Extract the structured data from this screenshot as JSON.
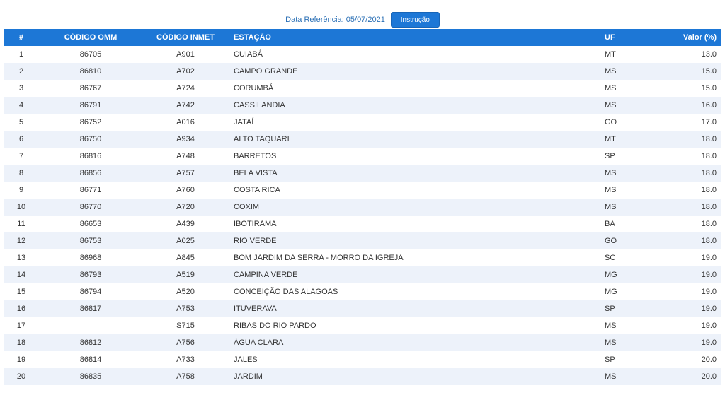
{
  "header": {
    "ref_label": "Data Referência: 05/07/2021",
    "instruction_button": "Instrução"
  },
  "table": {
    "columns": [
      "#",
      "CÓDIGO OMM",
      "CÓDIGO INMET",
      "ESTAÇÃO",
      "UF",
      "Valor (%)"
    ],
    "rows": [
      {
        "n": "1",
        "omm": "86705",
        "inmet": "A901",
        "estacao": "CUIABÁ",
        "uf": "MT",
        "valor": "13.0"
      },
      {
        "n": "2",
        "omm": "86810",
        "inmet": "A702",
        "estacao": "CAMPO GRANDE",
        "uf": "MS",
        "valor": "15.0"
      },
      {
        "n": "3",
        "omm": "86767",
        "inmet": "A724",
        "estacao": "CORUMBÁ",
        "uf": "MS",
        "valor": "15.0"
      },
      {
        "n": "4",
        "omm": "86791",
        "inmet": "A742",
        "estacao": "CASSILANDIA",
        "uf": "MS",
        "valor": "16.0"
      },
      {
        "n": "5",
        "omm": "86752",
        "inmet": "A016",
        "estacao": "JATAÍ",
        "uf": "GO",
        "valor": "17.0"
      },
      {
        "n": "6",
        "omm": "86750",
        "inmet": "A934",
        "estacao": "ALTO TAQUARI",
        "uf": "MT",
        "valor": "18.0"
      },
      {
        "n": "7",
        "omm": "86816",
        "inmet": "A748",
        "estacao": "BARRETOS",
        "uf": "SP",
        "valor": "18.0"
      },
      {
        "n": "8",
        "omm": "86856",
        "inmet": "A757",
        "estacao": "BELA VISTA",
        "uf": "MS",
        "valor": "18.0"
      },
      {
        "n": "9",
        "omm": "86771",
        "inmet": "A760",
        "estacao": "COSTA RICA",
        "uf": "MS",
        "valor": "18.0"
      },
      {
        "n": "10",
        "omm": "86770",
        "inmet": "A720",
        "estacao": "COXIM",
        "uf": "MS",
        "valor": "18.0"
      },
      {
        "n": "11",
        "omm": "86653",
        "inmet": "A439",
        "estacao": "IBOTIRAMA",
        "uf": "BA",
        "valor": "18.0"
      },
      {
        "n": "12",
        "omm": "86753",
        "inmet": "A025",
        "estacao": "RIO VERDE",
        "uf": "GO",
        "valor": "18.0"
      },
      {
        "n": "13",
        "omm": "86968",
        "inmet": "A845",
        "estacao": "BOM JARDIM DA SERRA - MORRO DA IGREJA",
        "uf": "SC",
        "valor": "19.0"
      },
      {
        "n": "14",
        "omm": "86793",
        "inmet": "A519",
        "estacao": "CAMPINA VERDE",
        "uf": "MG",
        "valor": "19.0"
      },
      {
        "n": "15",
        "omm": "86794",
        "inmet": "A520",
        "estacao": "CONCEIÇÃO DAS ALAGOAS",
        "uf": "MG",
        "valor": "19.0"
      },
      {
        "n": "16",
        "omm": "86817",
        "inmet": "A753",
        "estacao": "ITUVERAVA",
        "uf": "SP",
        "valor": "19.0"
      },
      {
        "n": "17",
        "omm": "",
        "inmet": "S715",
        "estacao": "RIBAS DO RIO PARDO",
        "uf": "MS",
        "valor": "19.0"
      },
      {
        "n": "18",
        "omm": "86812",
        "inmet": "A756",
        "estacao": "ÁGUA CLARA",
        "uf": "MS",
        "valor": "19.0"
      },
      {
        "n": "19",
        "omm": "86814",
        "inmet": "A733",
        "estacao": "JALES",
        "uf": "SP",
        "valor": "20.0"
      },
      {
        "n": "20",
        "omm": "86835",
        "inmet": "A758",
        "estacao": "JARDIM",
        "uf": "MS",
        "valor": "20.0"
      }
    ]
  },
  "colors": {
    "header_bg": "#1d77d6",
    "row_alt_bg": "#edf2fa",
    "ref_label": "#2a6fb5"
  }
}
